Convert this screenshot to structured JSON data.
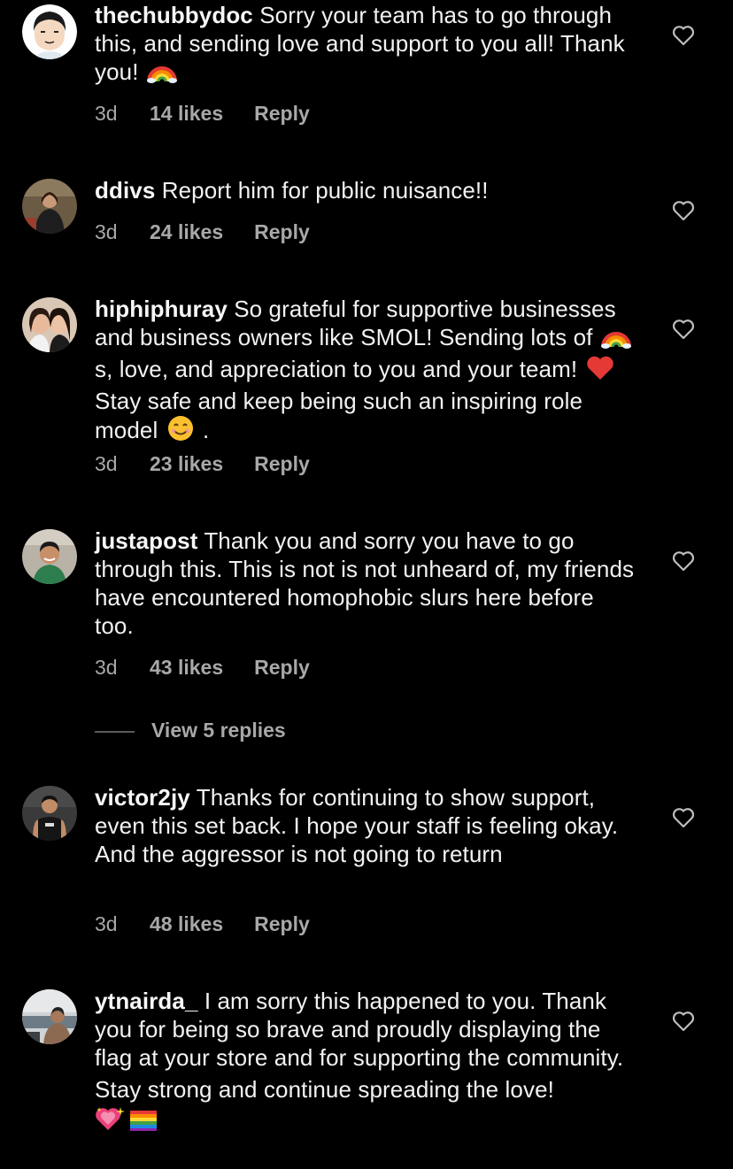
{
  "comments": [
    {
      "username": "thechubbydoc",
      "text": " Sorry your team has to go through this, and sending love and support to you all!  Thank you!",
      "time": "3d",
      "likes": "14 likes",
      "reply": "Reply",
      "emoji": [
        "rainbow-emoji"
      ]
    },
    {
      "username": "ddivs",
      "text": " Report him for public nuisance!!",
      "time": "3d",
      "likes": "24 likes",
      "reply": "Reply"
    },
    {
      "username": "hiphiphuray",
      "text_parts": [
        " So grateful for supportive businesses and business owners like SMOL! Sending lots of ",
        "s, love, and appreciation to you and your team! ",
        " Stay safe and keep being such an inspiring role model ",
        " ."
      ],
      "time": "3d",
      "likes": "23 likes",
      "reply": "Reply",
      "emoji": [
        "rainbow-emoji",
        "red-heart-emoji",
        "smiling-face-emoji"
      ]
    },
    {
      "username": "justapost",
      "text": " Thank you and sorry you have to go through this. This is not is not unheard of, my friends have encountered homophobic slurs here before too.",
      "time": "3d",
      "likes": "43 likes",
      "reply": "Reply",
      "view_replies": "View 5 replies"
    },
    {
      "username": "victor2jy",
      "text": " Thanks for continuing to show support, even this set back. I hope your staff is feeling okay. And the aggressor is not going to return",
      "time": "3d",
      "likes": "48 likes",
      "reply": "Reply"
    },
    {
      "username": "ytnairda_",
      "text": " I am sorry this happened to you. Thank you for being so brave and proudly displaying the flag at your store and for supporting the community.",
      "text2": "Stay strong and continue spreading the love!",
      "emoji": [
        "sparkling-heart-emoji",
        "rainbow-flag-emoji"
      ]
    }
  ],
  "colors": {
    "background": "#000000",
    "text": "#f2f2f2",
    "meta": "#a8a8a8"
  },
  "icons": {
    "like": "heart-outline-icon"
  }
}
